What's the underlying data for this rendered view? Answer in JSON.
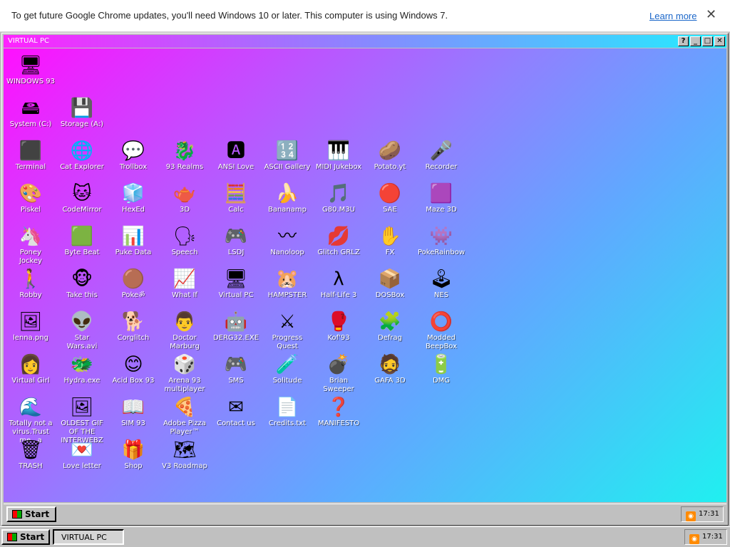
{
  "infobar": {
    "message": "To get future Google Chrome updates, you'll need Windows 10 or later. This computer is using Windows 7.",
    "learn_more": "Learn more",
    "close": "✕"
  },
  "window": {
    "title": "VIRTUAL PC",
    "buttons": [
      "?",
      "_",
      "□",
      "✕"
    ]
  },
  "icons": [
    {
      "label": "WINDOWS 93",
      "glyph": "🖥",
      "icon": "computer-icon"
    },
    {
      "label": "System (C:)",
      "glyph": "🖴",
      "icon": "drive-icon"
    },
    {
      "label": "Storage (A:)",
      "glyph": "💾",
      "icon": "floppy-icon"
    },
    {
      "label": "Terminal",
      "glyph": "⬛",
      "icon": "terminal-icon"
    },
    {
      "label": "Cat Explorer",
      "glyph": "🌐",
      "icon": "globe-icon"
    },
    {
      "label": "Trollbox",
      "glyph": "💬",
      "icon": "chat-icon"
    },
    {
      "label": "93 Realms",
      "glyph": "🐉",
      "icon": "dragon-icon"
    },
    {
      "label": "ANSI Love",
      "glyph": "🅰",
      "icon": "ansi-icon"
    },
    {
      "label": "ASCII Gallery",
      "glyph": "🔢",
      "icon": "ascii-icon"
    },
    {
      "label": "MIDI Jukebox",
      "glyph": "🎹",
      "icon": "piano-icon"
    },
    {
      "label": "Potato.yt",
      "glyph": "🥔",
      "icon": "potato-icon"
    },
    {
      "label": "Recorder",
      "glyph": "🎤",
      "icon": "microphone-icon"
    },
    {
      "label": "Piskel",
      "glyph": "🎨",
      "icon": "palette-icon"
    },
    {
      "label": "CodeMirror",
      "glyph": "🐱",
      "icon": "codemirror-icon"
    },
    {
      "label": "HexEd",
      "glyph": "🧊",
      "icon": "cube-icon"
    },
    {
      "label": "3D",
      "glyph": "🫖",
      "icon": "teapot-icon"
    },
    {
      "label": "Calc",
      "glyph": "🧮",
      "icon": "calculator-icon"
    },
    {
      "label": "Bananamp",
      "glyph": "🍌",
      "icon": "banana-icon"
    },
    {
      "label": "G80.M3U",
      "glyph": "🎵",
      "icon": "playlist-icon"
    },
    {
      "label": "SAE",
      "glyph": "🔴",
      "icon": "amiga-ball-icon"
    },
    {
      "label": "Maze 3D",
      "glyph": "🟪",
      "icon": "maze-icon"
    },
    {
      "label": "Poney\nJockey",
      "glyph": "🦄",
      "icon": "pony-icon"
    },
    {
      "label": "Byte Beat",
      "glyph": "🟩",
      "icon": "bytebeat-icon"
    },
    {
      "label": "Puke Data",
      "glyph": "📊",
      "icon": "pd-icon"
    },
    {
      "label": "Speech",
      "glyph": "🗣",
      "icon": "face-icon"
    },
    {
      "label": "LSDJ",
      "glyph": "🎮",
      "icon": "gameboy-icon"
    },
    {
      "label": "Nanoloop",
      "glyph": "〰",
      "icon": "wave-icon"
    },
    {
      "label": "Glitch GRLZ",
      "glyph": "💋",
      "icon": "lips-icon"
    },
    {
      "label": "FX",
      "glyph": "✋",
      "icon": "hand-cursor-icon"
    },
    {
      "label": "PokeRainbow",
      "glyph": "👾",
      "icon": "pokemon-icon"
    },
    {
      "label": "Robby",
      "glyph": "🚶",
      "icon": "stickman-icon"
    },
    {
      "label": "Take this",
      "glyph": "🐵",
      "icon": "monkey-icon"
    },
    {
      "label": "Pokeॐ",
      "glyph": "🟤",
      "icon": "pokeball-icon"
    },
    {
      "label": "What If",
      "glyph": "📈",
      "icon": "whatif-icon"
    },
    {
      "label": "Virtual PC",
      "glyph": "🖥",
      "icon": "virtual-pc-icon"
    },
    {
      "label": "HAMPSTER",
      "glyph": "🐹",
      "icon": "hamster-icon"
    },
    {
      "label": "Half-Life 3",
      "glyph": "λ",
      "icon": "halflife-icon"
    },
    {
      "label": "DOSBox",
      "glyph": "📦",
      "icon": "dosbox-icon"
    },
    {
      "label": "NES",
      "glyph": "🕹",
      "icon": "nes-icon"
    },
    {
      "label": "lenna.png",
      "glyph": "🖼",
      "icon": "image-file-icon"
    },
    {
      "label": "Star\nWars.avi",
      "glyph": "👽",
      "icon": "yoda-icon"
    },
    {
      "label": "Corglitch",
      "glyph": "🐕",
      "icon": "corgi-icon"
    },
    {
      "label": "Doctor\nMarburg",
      "glyph": "👨",
      "icon": "doctor-icon"
    },
    {
      "label": "DERG32.EXE",
      "glyph": "🤖",
      "icon": "derg-icon"
    },
    {
      "label": "Progress\nQuest",
      "glyph": "⚔",
      "icon": "swords-icon"
    },
    {
      "label": "Kof'93",
      "glyph": "🥊",
      "icon": "fighter-icon"
    },
    {
      "label": "Defrag",
      "glyph": "🧩",
      "icon": "defrag-icon"
    },
    {
      "label": "Modded\nBeepBox",
      "glyph": "⭕",
      "icon": "beepbox-icon"
    },
    {
      "label": "Virtual Girl",
      "glyph": "👩",
      "icon": "girl-icon"
    },
    {
      "label": "Hydra.exe",
      "glyph": "🐲",
      "icon": "hydra-icon"
    },
    {
      "label": "Acid Box 93",
      "glyph": "😊",
      "icon": "smiley-icon"
    },
    {
      "label": "Arena 93\nmultiplayer",
      "glyph": "🎲",
      "icon": "arena-cube-icon"
    },
    {
      "label": "SMS",
      "glyph": "🎮",
      "icon": "sms-console-icon"
    },
    {
      "label": "Solitude",
      "glyph": "🧪",
      "icon": "bottle-icon"
    },
    {
      "label": "Brian\nSweeper",
      "glyph": "💣",
      "icon": "mine-icon"
    },
    {
      "label": "GAFA 3D",
      "glyph": "🧔",
      "icon": "doomguy-icon"
    },
    {
      "label": "DMG",
      "glyph": "🔋",
      "icon": "dmg-icon"
    },
    {
      "label": "Totally not a\nvirus.Trust\nme...a\nd...",
      "glyph": "🌊",
      "icon": "virus-shortcut-icon"
    },
    {
      "label": "OLDEST GIF\nOF THE\nINTERWEBZ",
      "glyph": "🖼",
      "icon": "gif-file-icon"
    },
    {
      "label": "SIM 93",
      "glyph": "📖",
      "icon": "book-icon"
    },
    {
      "label": "Adobe Pizza\nPlayer™",
      "glyph": "🍕",
      "icon": "pizza-icon"
    },
    {
      "label": "Contact us",
      "glyph": "✉",
      "icon": "contact-icon"
    },
    {
      "label": "Credits.txt",
      "glyph": "📄",
      "icon": "text-file-icon"
    },
    {
      "label": "MANIFESTO",
      "glyph": "❓",
      "icon": "question-icon"
    },
    {
      "label": "TRASH",
      "glyph": "🗑",
      "icon": "trash-icon"
    },
    {
      "label": "Love letter",
      "glyph": "💌",
      "icon": "envelope-icon"
    },
    {
      "label": "Shop",
      "glyph": "🎁",
      "icon": "gift-icon"
    },
    {
      "label": "V3 Roadmap",
      "glyph": "🗺",
      "icon": "map-icon"
    }
  ],
  "inner_taskbar": {
    "start_label": "Start",
    "clock": "17:31"
  },
  "outer_taskbar": {
    "start_label": "Start",
    "window_button": "VIRTUAL PC",
    "clock": "17:31"
  }
}
